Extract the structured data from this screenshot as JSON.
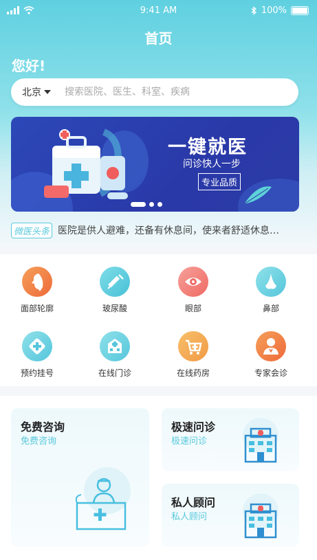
{
  "status": {
    "time": "9:41 AM",
    "battery": "100%"
  },
  "header": {
    "title": "首页",
    "greeting": "您好!"
  },
  "search": {
    "city": "北京",
    "placeholder": "搜索医院、医生、科室、疾病"
  },
  "banner": {
    "headline": "一键就医",
    "subline": "问诊快人一步",
    "tag": "专业品质"
  },
  "news": {
    "badge": "微医头条",
    "text": "医院是供人避难，还备有休息间，使来者舒适休息的地方"
  },
  "categories": [
    {
      "label": "面部轮廓",
      "icon": "face-profile-icon",
      "color": "#f07a45"
    },
    {
      "label": "玻尿酸",
      "icon": "syringe-icon",
      "color": "#5bcde0"
    },
    {
      "label": "眼部",
      "icon": "eye-icon",
      "color": "#f07a6a"
    },
    {
      "label": "鼻部",
      "icon": "nose-icon",
      "color": "#5bcde0"
    },
    {
      "label": "预约挂号",
      "icon": "medical-plus-icon",
      "color": "#5bcde0"
    },
    {
      "label": "在线门诊",
      "icon": "hospital-building-icon",
      "color": "#5bcde0"
    },
    {
      "label": "在线药房",
      "icon": "pharmacy-cart-icon",
      "color": "#f09a45"
    },
    {
      "label": "专家会诊",
      "icon": "doctor-icon",
      "color": "#f07a45"
    }
  ],
  "cards": [
    {
      "title": "免费咨询",
      "subtitle": "免费咨询"
    },
    {
      "title": "极速问诊",
      "subtitle": "极速问诊"
    },
    {
      "title": "私人顾问",
      "subtitle": "私人顾问"
    }
  ],
  "colors": {
    "accent": "#58c9dc",
    "banner": "#2c48b8"
  }
}
